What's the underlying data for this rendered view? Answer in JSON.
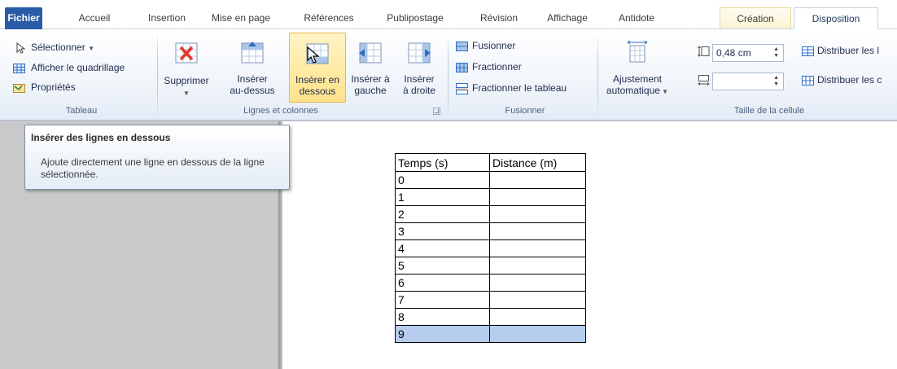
{
  "tabs": [
    {
      "label": "Fichier",
      "kind": "file"
    },
    {
      "label": "Accueil",
      "kind": "normal"
    },
    {
      "label": "Insertion",
      "kind": "normal"
    },
    {
      "label": "Mise en page",
      "kind": "normal"
    },
    {
      "label": "Références",
      "kind": "normal"
    },
    {
      "label": "Publipostage",
      "kind": "normal"
    },
    {
      "label": "Révision",
      "kind": "normal"
    },
    {
      "label": "Affichage",
      "kind": "normal"
    },
    {
      "label": "Antidote",
      "kind": "normal"
    },
    {
      "label": "Création",
      "kind": "contextual"
    },
    {
      "label": "Disposition",
      "kind": "contextual-active"
    }
  ],
  "ribbon": {
    "tableau": {
      "label": "Tableau",
      "select": "Sélectionner",
      "gridlines": "Afficher le quadrillage",
      "properties": "Propriétés"
    },
    "rows_cols": {
      "label": "Lignes et colonnes",
      "delete_line1": "Supprimer",
      "insert_above_line1": "Insérer",
      "insert_above_line2": "au-dessus",
      "insert_below_line1": "Insérer en",
      "insert_below_line2": "dessous",
      "insert_left_line1": "Insérer à",
      "insert_left_line2": "gauche",
      "insert_right_line1": "Insérer",
      "insert_right_line2": "à droite"
    },
    "merge": {
      "label": "Fusionner",
      "merge": "Fusionner",
      "split": "Fractionner",
      "split_table": "Fractionner le tableau"
    },
    "cell_size": {
      "label": "Taille de la cellule",
      "autofit_line1": "Ajustement",
      "autofit_line2": "automatique",
      "height_value": "0,48 cm",
      "width_value": "",
      "distribute_rows": "Distribuer les l",
      "distribute_cols": "Distribuer les c"
    }
  },
  "tooltip": {
    "title": "Insérer des lignes en dessous",
    "body": "Ajoute directement une ligne en dessous de la ligne sélectionnée."
  },
  "document_table": {
    "headers": [
      "Temps (s)",
      "Distance (m)"
    ],
    "rows": [
      "0",
      "1",
      "2",
      "3",
      "4",
      "5",
      "6",
      "7",
      "8",
      "9"
    ],
    "selected_row": "9"
  },
  "colors": {
    "file_tab": "#2a5ba8",
    "selected_row": "#b6cdee",
    "hover_button": "#ffe28a"
  }
}
